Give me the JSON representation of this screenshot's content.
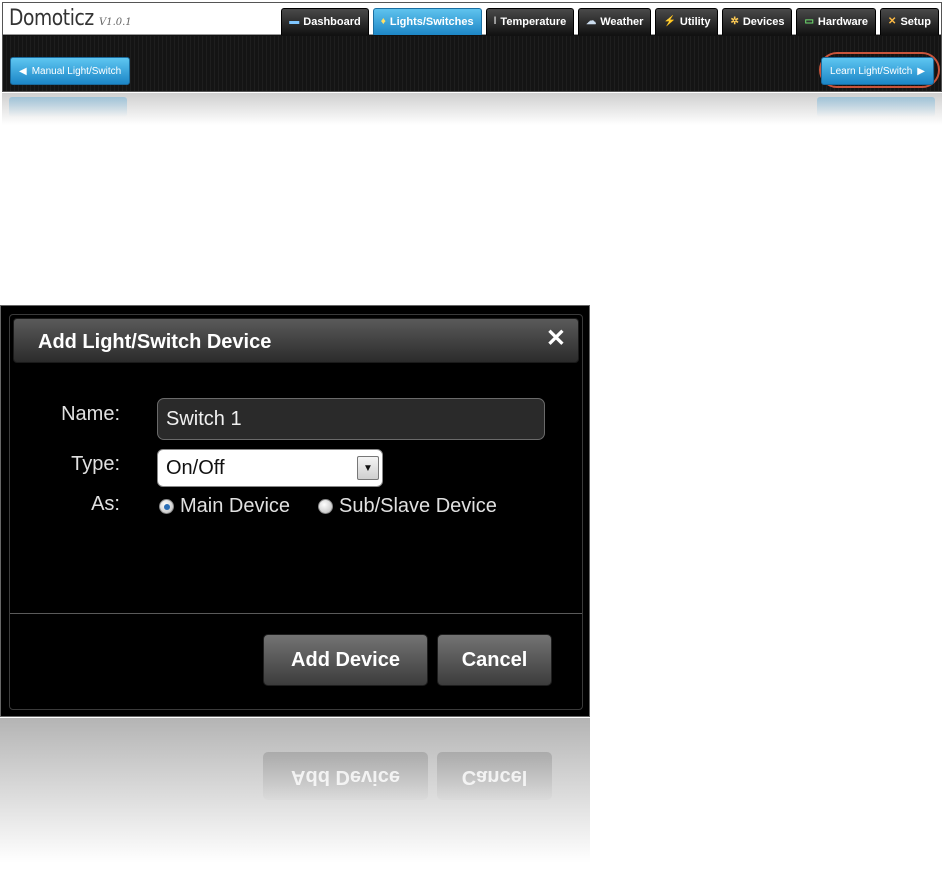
{
  "app": {
    "logo": "Domoticz",
    "version": "V1.0.1"
  },
  "nav": {
    "tabs": [
      {
        "label": "Dashboard",
        "icon": "monitor-icon",
        "active": false
      },
      {
        "label": "Lights/Switches",
        "icon": "bulb-icon",
        "active": true
      },
      {
        "label": "Temperature",
        "icon": "thermometer-icon",
        "active": false
      },
      {
        "label": "Weather",
        "icon": "cloud-icon",
        "active": false
      },
      {
        "label": "Utility",
        "icon": "lightning-icon",
        "active": false
      },
      {
        "label": "Devices",
        "icon": "gear-icon",
        "active": false
      },
      {
        "label": "Hardware",
        "icon": "circuit-board-icon",
        "active": false
      },
      {
        "label": "Setup",
        "icon": "tools-icon",
        "active": false
      }
    ]
  },
  "subbar": {
    "manual_label": "Manual Light/Switch",
    "learn_label": "Learn Light/Switch"
  },
  "dialog": {
    "title": "Add Light/Switch Device",
    "name_label": "Name:",
    "name_value": "Switch 1",
    "type_label": "Type:",
    "type_value": "On/Off",
    "as_label": "As:",
    "as_options": [
      "Main Device",
      "Sub/Slave Device"
    ],
    "as_selected": "Main Device",
    "add_label": "Add Device",
    "cancel_label": "Cancel"
  },
  "colors": {
    "accent": "#1d86c6",
    "highlight_ring": "#c8543a",
    "dialog_bg": "#000000"
  }
}
